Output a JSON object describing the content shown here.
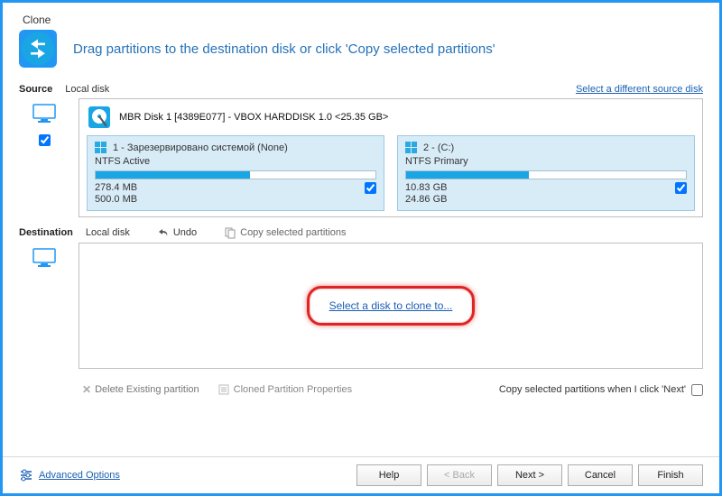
{
  "window": {
    "title": "Clone"
  },
  "instruction": "Drag partitions to the destination disk or click 'Copy selected partitions'",
  "source": {
    "label": "Source",
    "sub": "Local disk",
    "different_link": "Select a different source disk",
    "disk_title": "MBR Disk 1 [4389E077] - VBOX HARDDISK 1.0  <25.35 GB>",
    "partitions": [
      {
        "name": "1 - Зарезервировано системой (None)",
        "type": "NTFS Active",
        "used": "278.4 MB",
        "total": "500.0 MB",
        "fill_pct": 55
      },
      {
        "name": "2 -  (C:)",
        "type": "NTFS Primary",
        "used": "10.83 GB",
        "total": "24.86 GB",
        "fill_pct": 44
      }
    ]
  },
  "destination": {
    "label": "Destination",
    "sub": "Local disk",
    "undo": "Undo",
    "copy_sel": "Copy selected partitions",
    "select_link": "Select a disk to clone to..."
  },
  "under": {
    "delete": "Delete Existing partition",
    "cloned_props": "Cloned Partition Properties",
    "copy_next": "Copy selected partitions when I click 'Next'"
  },
  "footer": {
    "advanced": "Advanced Options",
    "help": "Help",
    "back": "< Back",
    "next": "Next >",
    "cancel": "Cancel",
    "finish": "Finish"
  }
}
